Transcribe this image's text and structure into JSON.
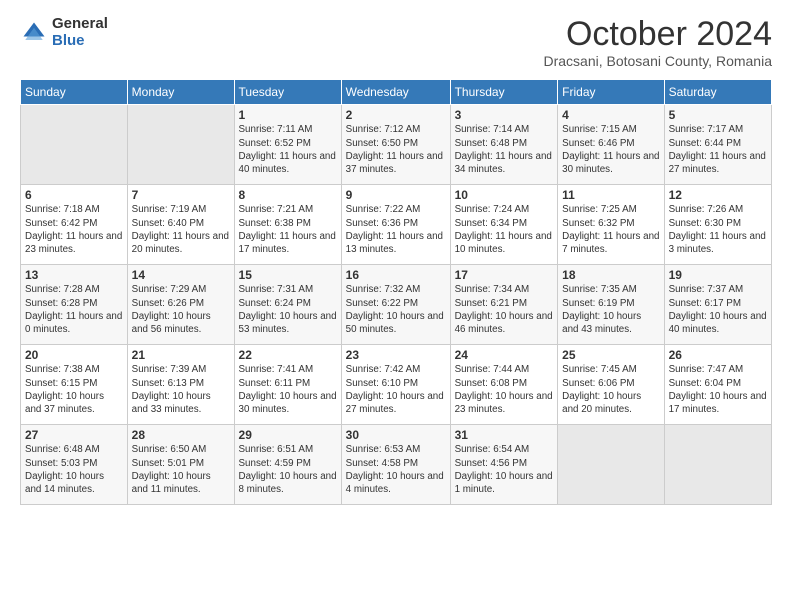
{
  "logo": {
    "general": "General",
    "blue": "Blue"
  },
  "header": {
    "month": "October 2024",
    "location": "Dracsani, Botosani County, Romania"
  },
  "days_of_week": [
    "Sunday",
    "Monday",
    "Tuesday",
    "Wednesday",
    "Thursday",
    "Friday",
    "Saturday"
  ],
  "weeks": [
    [
      {
        "day": "",
        "info": ""
      },
      {
        "day": "",
        "info": ""
      },
      {
        "day": "1",
        "info": "Sunrise: 7:11 AM\nSunset: 6:52 PM\nDaylight: 11 hours and 40 minutes."
      },
      {
        "day": "2",
        "info": "Sunrise: 7:12 AM\nSunset: 6:50 PM\nDaylight: 11 hours and 37 minutes."
      },
      {
        "day": "3",
        "info": "Sunrise: 7:14 AM\nSunset: 6:48 PM\nDaylight: 11 hours and 34 minutes."
      },
      {
        "day": "4",
        "info": "Sunrise: 7:15 AM\nSunset: 6:46 PM\nDaylight: 11 hours and 30 minutes."
      },
      {
        "day": "5",
        "info": "Sunrise: 7:17 AM\nSunset: 6:44 PM\nDaylight: 11 hours and 27 minutes."
      }
    ],
    [
      {
        "day": "6",
        "info": "Sunrise: 7:18 AM\nSunset: 6:42 PM\nDaylight: 11 hours and 23 minutes."
      },
      {
        "day": "7",
        "info": "Sunrise: 7:19 AM\nSunset: 6:40 PM\nDaylight: 11 hours and 20 minutes."
      },
      {
        "day": "8",
        "info": "Sunrise: 7:21 AM\nSunset: 6:38 PM\nDaylight: 11 hours and 17 minutes."
      },
      {
        "day": "9",
        "info": "Sunrise: 7:22 AM\nSunset: 6:36 PM\nDaylight: 11 hours and 13 minutes."
      },
      {
        "day": "10",
        "info": "Sunrise: 7:24 AM\nSunset: 6:34 PM\nDaylight: 11 hours and 10 minutes."
      },
      {
        "day": "11",
        "info": "Sunrise: 7:25 AM\nSunset: 6:32 PM\nDaylight: 11 hours and 7 minutes."
      },
      {
        "day": "12",
        "info": "Sunrise: 7:26 AM\nSunset: 6:30 PM\nDaylight: 11 hours and 3 minutes."
      }
    ],
    [
      {
        "day": "13",
        "info": "Sunrise: 7:28 AM\nSunset: 6:28 PM\nDaylight: 11 hours and 0 minutes."
      },
      {
        "day": "14",
        "info": "Sunrise: 7:29 AM\nSunset: 6:26 PM\nDaylight: 10 hours and 56 minutes."
      },
      {
        "day": "15",
        "info": "Sunrise: 7:31 AM\nSunset: 6:24 PM\nDaylight: 10 hours and 53 minutes."
      },
      {
        "day": "16",
        "info": "Sunrise: 7:32 AM\nSunset: 6:22 PM\nDaylight: 10 hours and 50 minutes."
      },
      {
        "day": "17",
        "info": "Sunrise: 7:34 AM\nSunset: 6:21 PM\nDaylight: 10 hours and 46 minutes."
      },
      {
        "day": "18",
        "info": "Sunrise: 7:35 AM\nSunset: 6:19 PM\nDaylight: 10 hours and 43 minutes."
      },
      {
        "day": "19",
        "info": "Sunrise: 7:37 AM\nSunset: 6:17 PM\nDaylight: 10 hours and 40 minutes."
      }
    ],
    [
      {
        "day": "20",
        "info": "Sunrise: 7:38 AM\nSunset: 6:15 PM\nDaylight: 10 hours and 37 minutes."
      },
      {
        "day": "21",
        "info": "Sunrise: 7:39 AM\nSunset: 6:13 PM\nDaylight: 10 hours and 33 minutes."
      },
      {
        "day": "22",
        "info": "Sunrise: 7:41 AM\nSunset: 6:11 PM\nDaylight: 10 hours and 30 minutes."
      },
      {
        "day": "23",
        "info": "Sunrise: 7:42 AM\nSunset: 6:10 PM\nDaylight: 10 hours and 27 minutes."
      },
      {
        "day": "24",
        "info": "Sunrise: 7:44 AM\nSunset: 6:08 PM\nDaylight: 10 hours and 23 minutes."
      },
      {
        "day": "25",
        "info": "Sunrise: 7:45 AM\nSunset: 6:06 PM\nDaylight: 10 hours and 20 minutes."
      },
      {
        "day": "26",
        "info": "Sunrise: 7:47 AM\nSunset: 6:04 PM\nDaylight: 10 hours and 17 minutes."
      }
    ],
    [
      {
        "day": "27",
        "info": "Sunrise: 6:48 AM\nSunset: 5:03 PM\nDaylight: 10 hours and 14 minutes."
      },
      {
        "day": "28",
        "info": "Sunrise: 6:50 AM\nSunset: 5:01 PM\nDaylight: 10 hours and 11 minutes."
      },
      {
        "day": "29",
        "info": "Sunrise: 6:51 AM\nSunset: 4:59 PM\nDaylight: 10 hours and 8 minutes."
      },
      {
        "day": "30",
        "info": "Sunrise: 6:53 AM\nSunset: 4:58 PM\nDaylight: 10 hours and 4 minutes."
      },
      {
        "day": "31",
        "info": "Sunrise: 6:54 AM\nSunset: 4:56 PM\nDaylight: 10 hours and 1 minute."
      },
      {
        "day": "",
        "info": ""
      },
      {
        "day": "",
        "info": ""
      }
    ]
  ]
}
